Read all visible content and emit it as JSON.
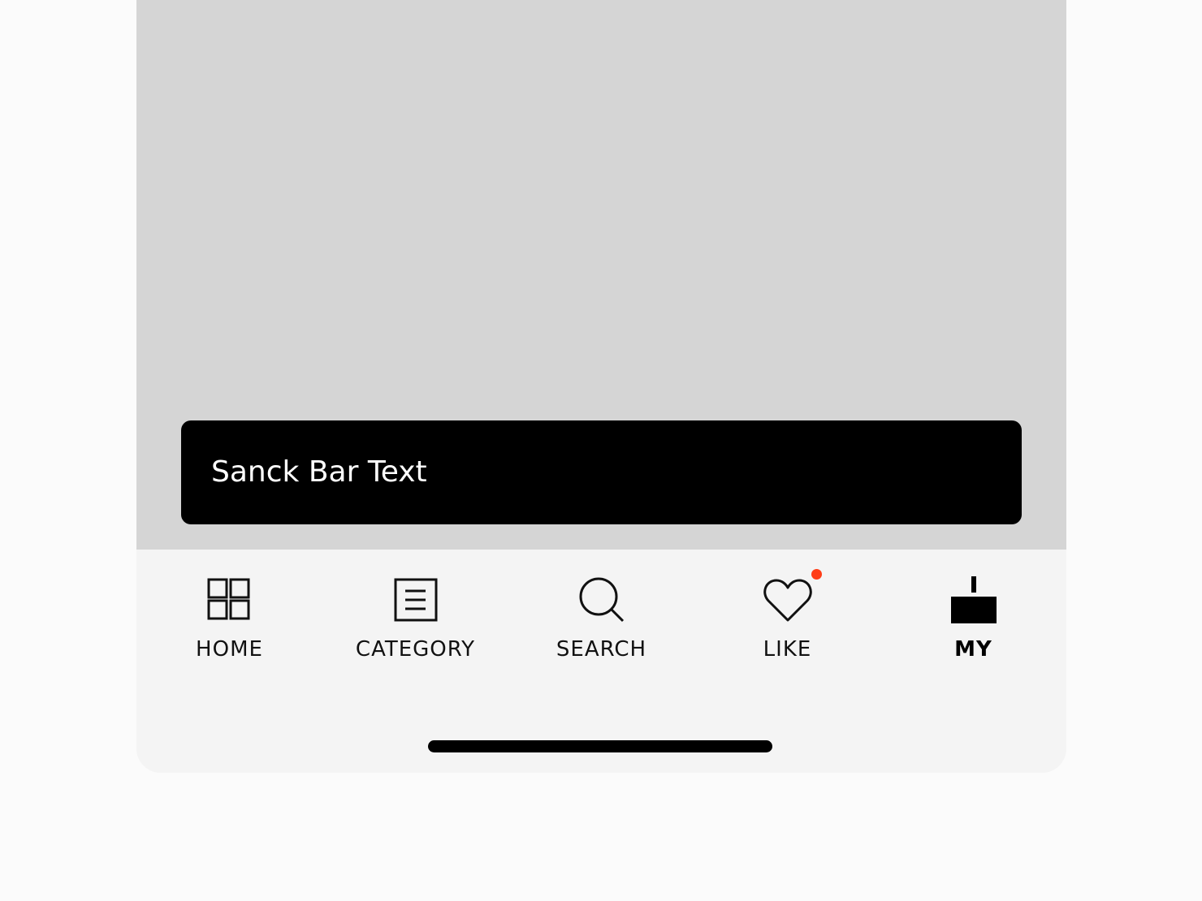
{
  "snackbar": {
    "text": "Sanck Bar Text"
  },
  "tabbar": {
    "items": [
      {
        "label": "HOME",
        "icon": "grid-icon",
        "active": false
      },
      {
        "label": "CATEGORY",
        "icon": "list-document-icon",
        "active": false
      },
      {
        "label": "SEARCH",
        "icon": "search-icon",
        "active": false
      },
      {
        "label": "LIKE",
        "icon": "heart-icon",
        "active": false,
        "badge": true
      },
      {
        "label": "MY",
        "icon": "my-page-icon",
        "active": true
      }
    ]
  },
  "colors": {
    "content_background": "#d5d5d5",
    "tabbar_background": "#f4f4f4",
    "snackbar_background": "#000000",
    "badge": "#ff3d17"
  }
}
